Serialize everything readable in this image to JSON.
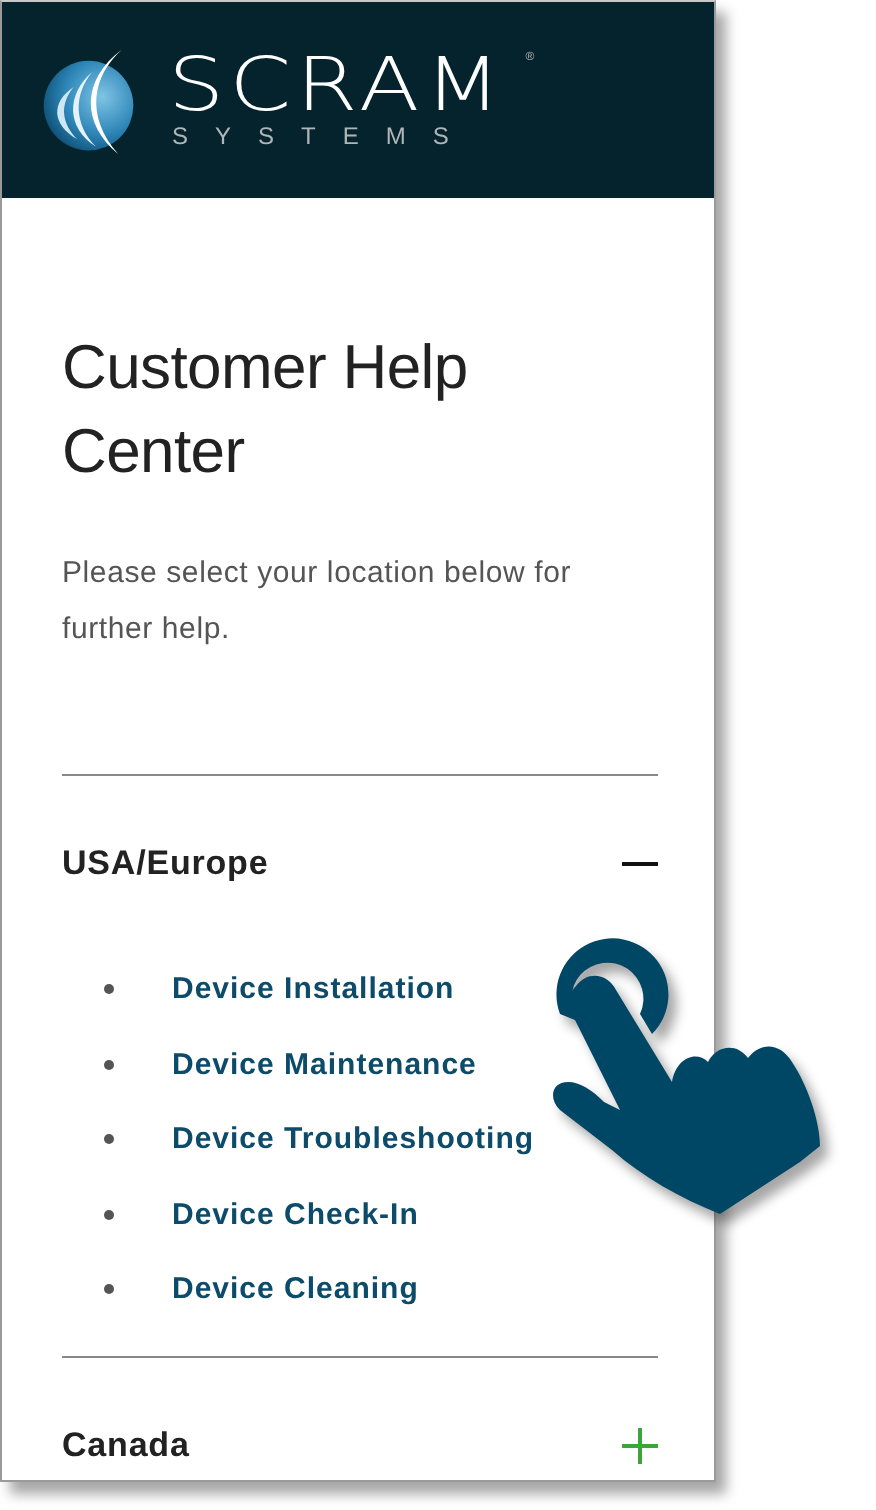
{
  "header": {
    "logo_name": "SCRAM",
    "logo_mark": "®",
    "logo_sub": "SYSTEMS"
  },
  "title": "Customer Help Center",
  "intro": "Please select your location below for further help.",
  "sections": [
    {
      "label": "USA/Europe",
      "expanded": true,
      "links": [
        "Device Installation",
        "Device Maintenance",
        "Device Troubleshooting",
        "Device Check-In",
        "Device Cleaning"
      ]
    },
    {
      "label": "Canada",
      "expanded": false
    }
  ]
}
